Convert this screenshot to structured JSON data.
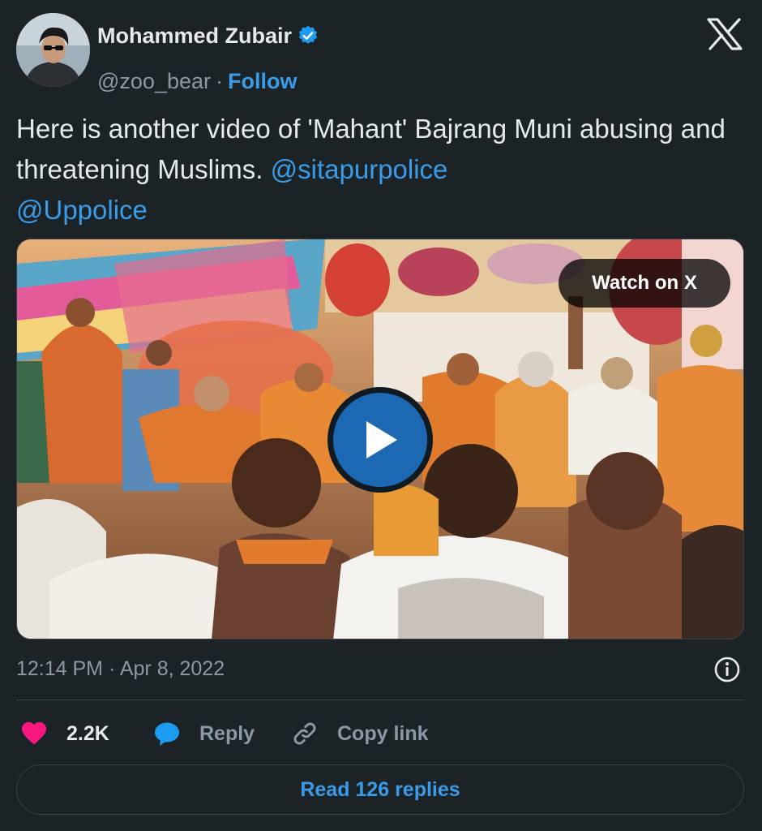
{
  "author": {
    "display_name": "Mohammed Zubair",
    "handle": "@zoo_bear",
    "separator": "·",
    "follow_label": "Follow",
    "verified": true
  },
  "brand": {
    "logo_icon": "x-logo-icon"
  },
  "tweet": {
    "text_before": "Here is another video of 'Mahant' Bajrang Muni abusing and threatening Muslims. ",
    "mention_1": "@sitapurpolice",
    "mention_2": "@Uppolice"
  },
  "media": {
    "watch_label": "Watch on X",
    "play_icon": "play-icon"
  },
  "meta": {
    "timestamp": "12:14 PM · Apr 8, 2022",
    "info_icon": "info-icon"
  },
  "actions": {
    "like_count": "2.2K",
    "reply_label": "Reply",
    "copy_label": "Copy link"
  },
  "replies": {
    "read_label": "Read 126 replies"
  },
  "colors": {
    "background": "#1c2326",
    "text": "#e7e9ea",
    "muted": "#8b98a5",
    "link": "#3a9ce8",
    "like": "#f91880",
    "verified": "#1d9bf0",
    "border": "#3a4248"
  }
}
